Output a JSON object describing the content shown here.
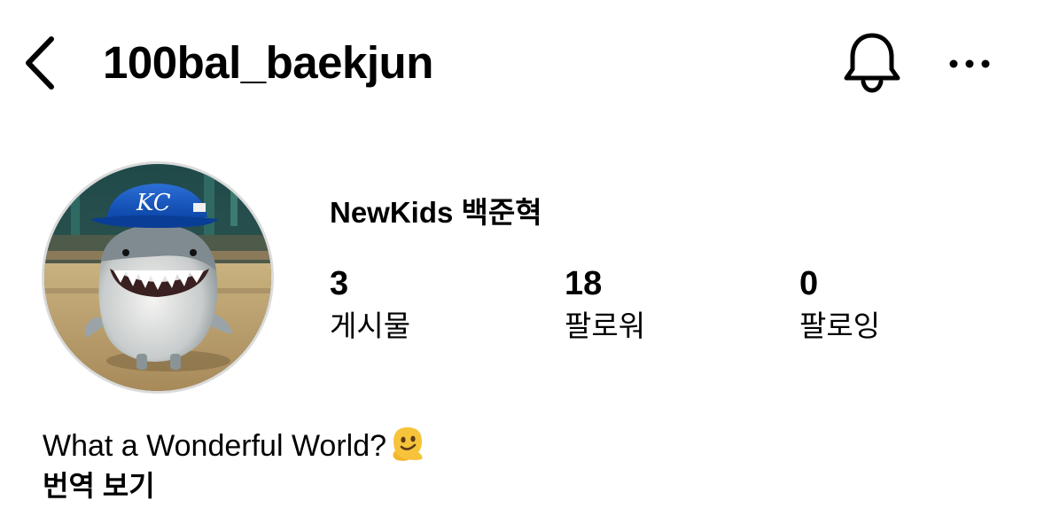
{
  "header": {
    "username": "100bal_baekjun",
    "back_icon": "chevron-left-icon",
    "notification_icon": "bell-icon",
    "more_icon": "more-horizontal-icon"
  },
  "profile": {
    "avatar_description": "shark character wearing a blue KC baseball cap",
    "display_name": "NewKids 백준혁",
    "stats": [
      {
        "count": "3",
        "label": "게시물"
      },
      {
        "count": "18",
        "label": "팔로워"
      },
      {
        "count": "0",
        "label": "팔로잉"
      }
    ],
    "bio": "What a Wonderful World?",
    "bio_emoji": "melting-face-emoji",
    "translate_label": "번역 보기"
  },
  "colors": {
    "text": "#000000",
    "background": "#ffffff",
    "avatar_border": "#dbdbdb"
  }
}
